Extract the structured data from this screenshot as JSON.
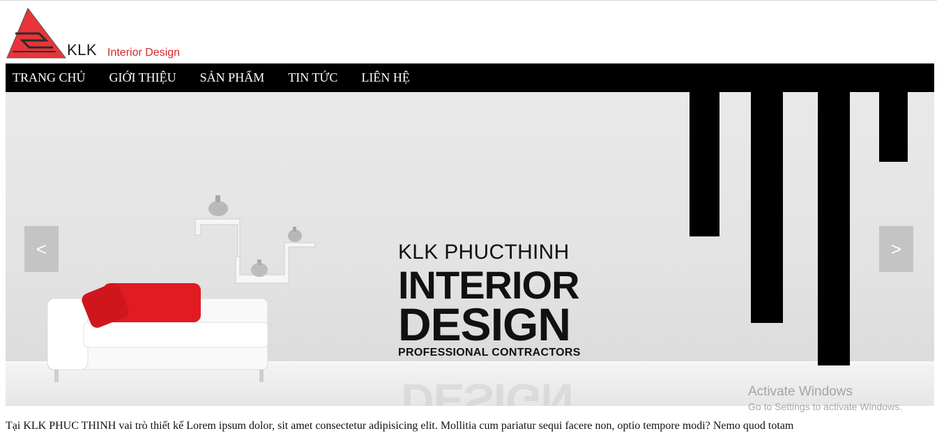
{
  "brand": {
    "name": "KLK",
    "tagline": "Interior Design",
    "colors": {
      "accent": "#d9262c",
      "nav_bg": "#000000"
    }
  },
  "nav": {
    "items": [
      "TRANG CHỦ",
      "GIỚI THIỆU",
      "SẢN PHẨM",
      "TIN TỨC",
      "LIÊN HỆ"
    ]
  },
  "slider": {
    "line1": "KLK PHUCTHINH",
    "line2": "INTERIOR",
    "line3": "DESIGN",
    "line4": "PROFESSIONAL CONTRACTORS",
    "prev_label": "<",
    "next_label": ">",
    "prev_icon": "chevron-left-icon",
    "next_icon": "chevron-right-icon"
  },
  "watermark": {
    "title": "Activate Windows",
    "subtitle": "Go to Settings to activate Windows."
  },
  "intro": {
    "text": "Tại KLK PHUC THINH vai trò thiết kế Lorem ipsum dolor, sit amet consectetur adipisicing elit. Mollitia cum pariatur sequi facere non, optio tempore modi? Nemo quod totam"
  }
}
